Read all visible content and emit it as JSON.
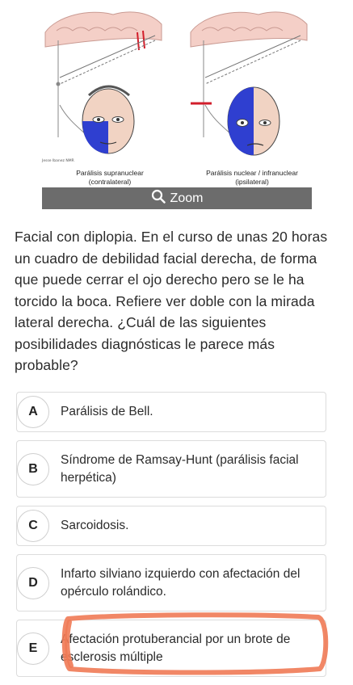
{
  "figure": {
    "left_caption_1": "Parálisis supranuclear",
    "left_caption_2": "(contralateral)",
    "right_caption_1": "Parálisis nuclear / infranuclear",
    "right_caption_2": "(ipsilateral)",
    "signature": "Jesse Ibanez NMR"
  },
  "zoom": {
    "label": "Zoom",
    "icon": "search-icon"
  },
  "question": "Facial con diplopia. En el curso de unas 20 horas un cuadro de debilidad facial derecha, de forma que puede cerrar el ojo derecho pero se le ha torcido la boca. Refiere ver doble con la mirada lateral derecha. ¿Cuál de las siguientes posibilidades diagnósticas le parece más probable?",
  "options": [
    {
      "letter": "A",
      "text": "Parálisis de Bell."
    },
    {
      "letter": "B",
      "text": "Síndrome de Ramsay-Hunt (parálisis facial herpética)"
    },
    {
      "letter": "C",
      "text": "Sarcoidosis."
    },
    {
      "letter": "D",
      "text": "Infarto silviano izquierdo con afectación del opérculo rolándico."
    },
    {
      "letter": "E",
      "text": "Afectación protuberancial por un brote de esclerosis múltiple"
    }
  ],
  "colors": {
    "face_blue": "#2f3fd0",
    "highlight": "#f07a55",
    "zoom_bar": "#6c6c6c"
  }
}
